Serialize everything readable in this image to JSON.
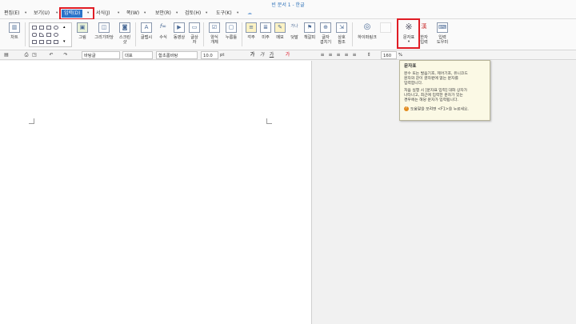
{
  "window": {
    "title": "빈 문서 1 - 한글"
  },
  "menu": {
    "items": [
      {
        "label": "편집(E)"
      },
      {
        "label": "보기(U)"
      },
      {
        "label": "입력(D)",
        "active": true
      },
      {
        "label": "서식(J)"
      },
      {
        "label": "쪽(W)"
      },
      {
        "label": "보안(R)"
      },
      {
        "label": "검토(H)"
      },
      {
        "label": "도구(K)"
      }
    ]
  },
  "ribbon": {
    "chart": "차트",
    "picture": "그림",
    "drawing_object": "그리기마당",
    "scan": "스크린\n샷",
    "textart": "글맵시",
    "formula": "수식",
    "video": "동영상",
    "textbox": "글상\n자",
    "field": "양식\n개체",
    "memo_stamp": "누름틀",
    "footnote": "각주",
    "endnote": "미주",
    "memo": "메모",
    "bookmark": "덧말",
    "headline": "책갈피",
    "hyperlink_text": "글자\n겹치기",
    "cross_ref": "상호\n참조",
    "hyperlink": "하이퍼링크",
    "char_map": "문자표",
    "char_input": "한자\n입력",
    "insert_doc": "입력\n도우미"
  },
  "format": {
    "style": "바탕글",
    "lang": "대표",
    "font": "함초롬바탕",
    "size": "10.0",
    "unit": "pt",
    "zoom": "160",
    "zoom_unit": "%"
  },
  "tooltip": {
    "title": "문자표",
    "body1": "분수 또는 발음기호, 제어기호, 유니코드\n문자와 같이 글자판에 없는 문자를\n입력합니다.",
    "body2": "처음 실행 시 [문자표 입력] 대화 상자가\n나타나고, 최근에 입력한 문자가 있는\n경우에는 해당 문자가 입력됩니다.",
    "help": "도움말을 보려면 <F1>을 누르세요."
  },
  "colors": {
    "accent": "#2a73c9",
    "highlight": "#e01c24",
    "tooltip_bg": "#fbf9e5"
  }
}
